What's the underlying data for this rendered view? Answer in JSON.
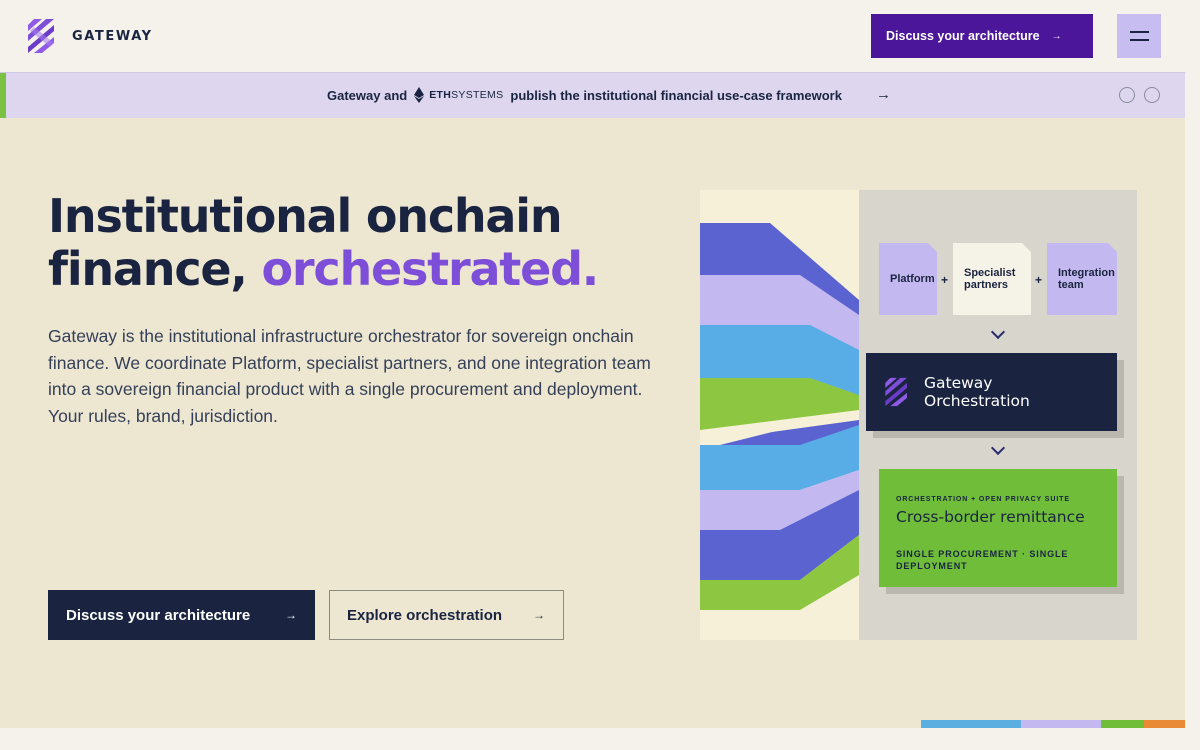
{
  "header": {
    "logo_text": "GATEWAY",
    "cta_label": "Discuss your architecture",
    "cta_arrow": "→"
  },
  "announcement": {
    "lead": "Gateway and",
    "partner_bold": "ETH",
    "partner_light": "SYSTEMS",
    "text": "publish the institutional financial use-case framework",
    "arrow": "→"
  },
  "hero": {
    "headline_line1": "Institutional onchain",
    "headline_line2_plain": "finance, ",
    "headline_line2_accent": "orchestrated.",
    "lede": "Gateway is the institutional infrastructure orchestrator for sovereign onchain finance. We coordinate Platform, specialist partners, and one integration team into a sovereign financial product with a single procurement and deployment. Your rules, brand, jurisdiction.",
    "primary_button": "Discuss your architecture",
    "secondary_button": "Explore orchestration",
    "button_arrow": "→"
  },
  "diagram": {
    "inputs": [
      "Platform",
      "Specialist partners",
      "Integration team"
    ],
    "plus": "+",
    "orchestration_title_line1": "Gateway",
    "orchestration_title_line2": "Orchestration",
    "result_eyebrow": "ORCHESTRATION + OPEN PRIVACY SUITE",
    "result_title": "Cross-border remittance",
    "result_footer": "SINGLE PROCUREMENT · SINGLE DEPLOYMENT"
  },
  "colors": {
    "navy": "#1a2440",
    "purple_cta": "#4b1699",
    "accent_purple": "#7d4ed8",
    "lavender": "#c8bdf0",
    "green": "#6fbd39",
    "blue": "#5aaee0"
  }
}
